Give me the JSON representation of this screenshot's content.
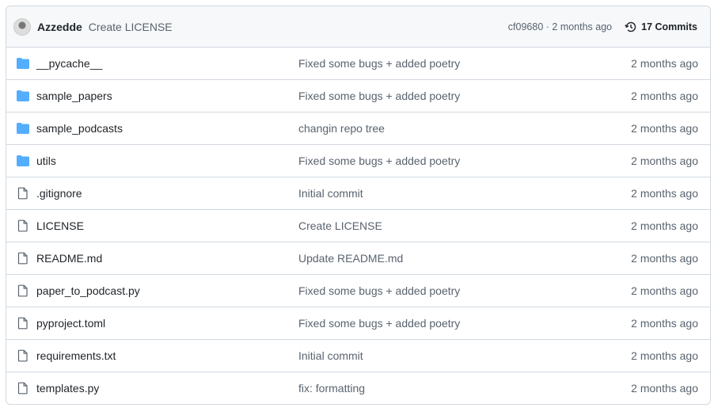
{
  "header": {
    "author": "Azzedde",
    "message": "Create LICENSE",
    "sha_time": "cf09680 · 2 months ago",
    "commits": "17 Commits"
  },
  "colors": {
    "folder": "#54aeff",
    "file": "#59636e"
  },
  "rows": [
    {
      "type": "folder",
      "name": "__pycache__",
      "commit": "Fixed some bugs + added poetry",
      "age": "2 months ago"
    },
    {
      "type": "folder",
      "name": "sample_papers",
      "commit": "Fixed some bugs + added poetry",
      "age": "2 months ago"
    },
    {
      "type": "folder",
      "name": "sample_podcasts",
      "commit": "changin repo tree",
      "age": "2 months ago"
    },
    {
      "type": "folder",
      "name": "utils",
      "commit": "Fixed some bugs + added poetry",
      "age": "2 months ago"
    },
    {
      "type": "file",
      "name": ".gitignore",
      "commit": "Initial commit",
      "age": "2 months ago"
    },
    {
      "type": "file",
      "name": "LICENSE",
      "commit": "Create LICENSE",
      "age": "2 months ago"
    },
    {
      "type": "file",
      "name": "README.md",
      "commit": "Update README.md",
      "age": "2 months ago"
    },
    {
      "type": "file",
      "name": "paper_to_podcast.py",
      "commit": "Fixed some bugs + added poetry",
      "age": "2 months ago"
    },
    {
      "type": "file",
      "name": "pyproject.toml",
      "commit": "Fixed some bugs + added poetry",
      "age": "2 months ago"
    },
    {
      "type": "file",
      "name": "requirements.txt",
      "commit": "Initial commit",
      "age": "2 months ago"
    },
    {
      "type": "file",
      "name": "templates.py",
      "commit": "fix: formatting",
      "age": "2 months ago"
    }
  ]
}
